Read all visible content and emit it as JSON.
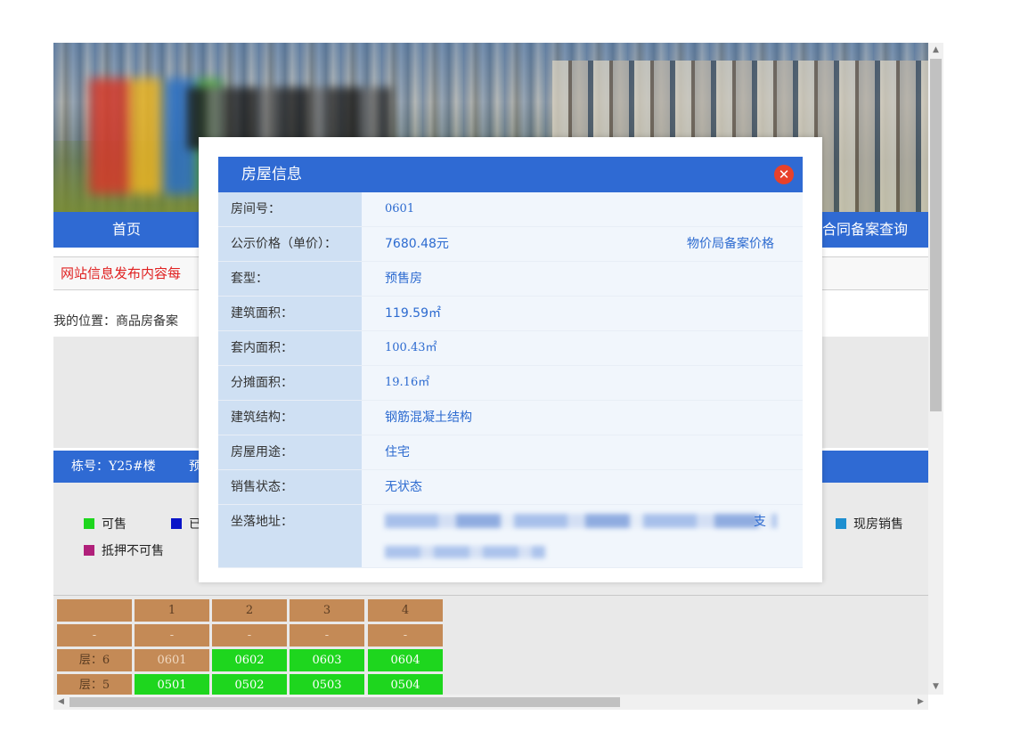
{
  "nav": {
    "home": "首页",
    "contract_query": "合同备案查询"
  },
  "notice": "网站信息发布内容每",
  "breadcrumb": "我的位置：商品房备案",
  "building": {
    "label": "栋号：Y25#楼",
    "label2": "预"
  },
  "legend": {
    "available": "可售",
    "sold_partial": "已",
    "existing": "现房销售",
    "mortgaged": "抵押不可售",
    "colors": {
      "available": "#1ed61e",
      "sold": "#0a14c8",
      "existing": "#1e8fd0",
      "mortgaged": "#b0207a"
    }
  },
  "grid": {
    "headers": [
      "1",
      "2",
      "3",
      "4"
    ],
    "dash_row": [
      "-",
      "-",
      "-",
      "-",
      "-"
    ],
    "floors": [
      {
        "label": "层：6",
        "units": [
          "0601",
          "0602",
          "0603",
          "0604"
        ]
      },
      {
        "label": "层：5",
        "units": [
          "0501",
          "0502",
          "0503",
          "0504"
        ]
      }
    ]
  },
  "modal": {
    "title": "房屋信息",
    "close": "✕",
    "rows": [
      {
        "label": "房间号：",
        "value": "0601"
      },
      {
        "label": "公示价格（单价）：",
        "value": "7680.48元",
        "extra": "物价局备案价格"
      },
      {
        "label": "套型：",
        "value": "预售房"
      },
      {
        "label": "建筑面积：",
        "value": "119.59㎡"
      },
      {
        "label": "套内面积：",
        "value": "100.43㎡"
      },
      {
        "label": "分摊面积：",
        "value": "19.16㎡"
      },
      {
        "label": "建筑结构：",
        "value": "钢筋混凝土结构"
      },
      {
        "label": "房屋用途：",
        "value": "住宅"
      },
      {
        "label": "销售状态：",
        "value": "无状态"
      },
      {
        "label": "坐落地址：",
        "value_suffix": "支"
      }
    ]
  }
}
